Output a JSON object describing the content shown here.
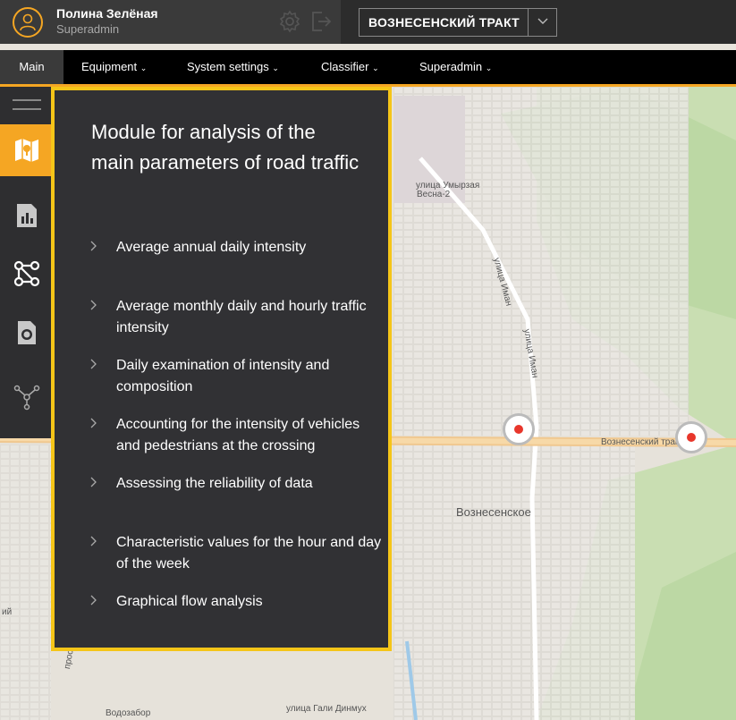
{
  "user": {
    "name": "Полина Зелёная",
    "role": "Superadmin"
  },
  "region": {
    "selected": "ВОЗНЕСЕНСКИЙ ТРАКТ"
  },
  "nav": {
    "items": [
      {
        "label": "Main"
      },
      {
        "label": "Equipment"
      },
      {
        "label": "System settings"
      },
      {
        "label": "Classifier"
      },
      {
        "label": "Superadmin"
      }
    ]
  },
  "panel": {
    "title": "Module for analysis of the main parameters of road traffic",
    "items": [
      {
        "label": "Average annual daily intensity"
      },
      {
        "label": "Average monthly daily and hourly traffic intensity"
      },
      {
        "label": "Daily examination of intensity and composition"
      },
      {
        "label": "Accounting for the intensity of vehicles and pedestrians at the crossing"
      },
      {
        "label": "Assessing the reliability of data"
      },
      {
        "label": "Characteristic values for the hour and day of the week"
      },
      {
        "label": "Graphical flow analysis"
      }
    ]
  },
  "map": {
    "labels": [
      "улица Умырзая",
      "Весна-2",
      "улица Иман",
      "улица Иман",
      "Вознесенский тракт",
      "Вознесенское",
      "улица Гали Динмух",
      "Водозабор",
      "проспект Победы",
      "ий"
    ]
  },
  "colors": {
    "accent": "#f5a623",
    "panel_border": "#f5c518",
    "panel_bg": "#313134",
    "marker": "#e8362b"
  },
  "icons": {
    "sidebar": [
      "map-icon",
      "bar-chart-icon",
      "graph-nodes-icon",
      "sim-card-icon",
      "network-icon"
    ],
    "header": [
      "avatar-icon",
      "gear-icon",
      "logout-icon",
      "chevron-down-icon"
    ]
  }
}
